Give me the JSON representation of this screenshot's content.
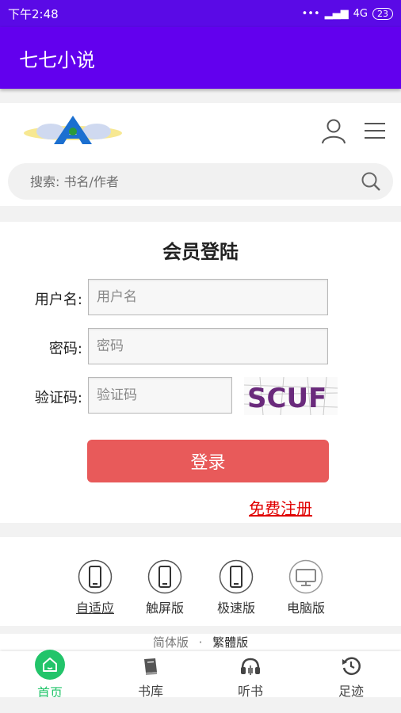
{
  "status_bar": {
    "time": "下午2:48",
    "network": "4G",
    "battery": "23"
  },
  "app_bar": {
    "title": "七七小说"
  },
  "search": {
    "placeholder": "搜索: 书名/作者"
  },
  "login": {
    "title": "会员登陆",
    "username_label": "用户名:",
    "username_placeholder": "用户名",
    "password_label": "密码:",
    "password_placeholder": "密码",
    "captcha_label": "验证码:",
    "captcha_placeholder": "验证码",
    "captcha_text": "SCUF",
    "login_button": "登录",
    "register_link": "免费注册"
  },
  "versions": [
    {
      "label": "自适应",
      "icon": "phone-icon",
      "active": true
    },
    {
      "label": "触屏版",
      "icon": "phone-icon",
      "active": false
    },
    {
      "label": "极速版",
      "icon": "phone-icon",
      "active": false
    },
    {
      "label": "电脑版",
      "icon": "monitor-icon",
      "active": false
    }
  ],
  "language": {
    "simplified": "简体版",
    "separator": "·",
    "traditional": "繁體版"
  },
  "tabs": [
    {
      "label": "首页",
      "icon": "home-icon",
      "active": true
    },
    {
      "label": "书库",
      "icon": "book-icon",
      "active": false
    },
    {
      "label": "听书",
      "icon": "headphones-icon",
      "active": false
    },
    {
      "label": "足迹",
      "icon": "history-icon",
      "active": false
    }
  ],
  "colors": {
    "app_bar": "#6200ee",
    "login_button": "#e85a5a",
    "register": "#e00000",
    "tab_active": "#22c46a"
  }
}
